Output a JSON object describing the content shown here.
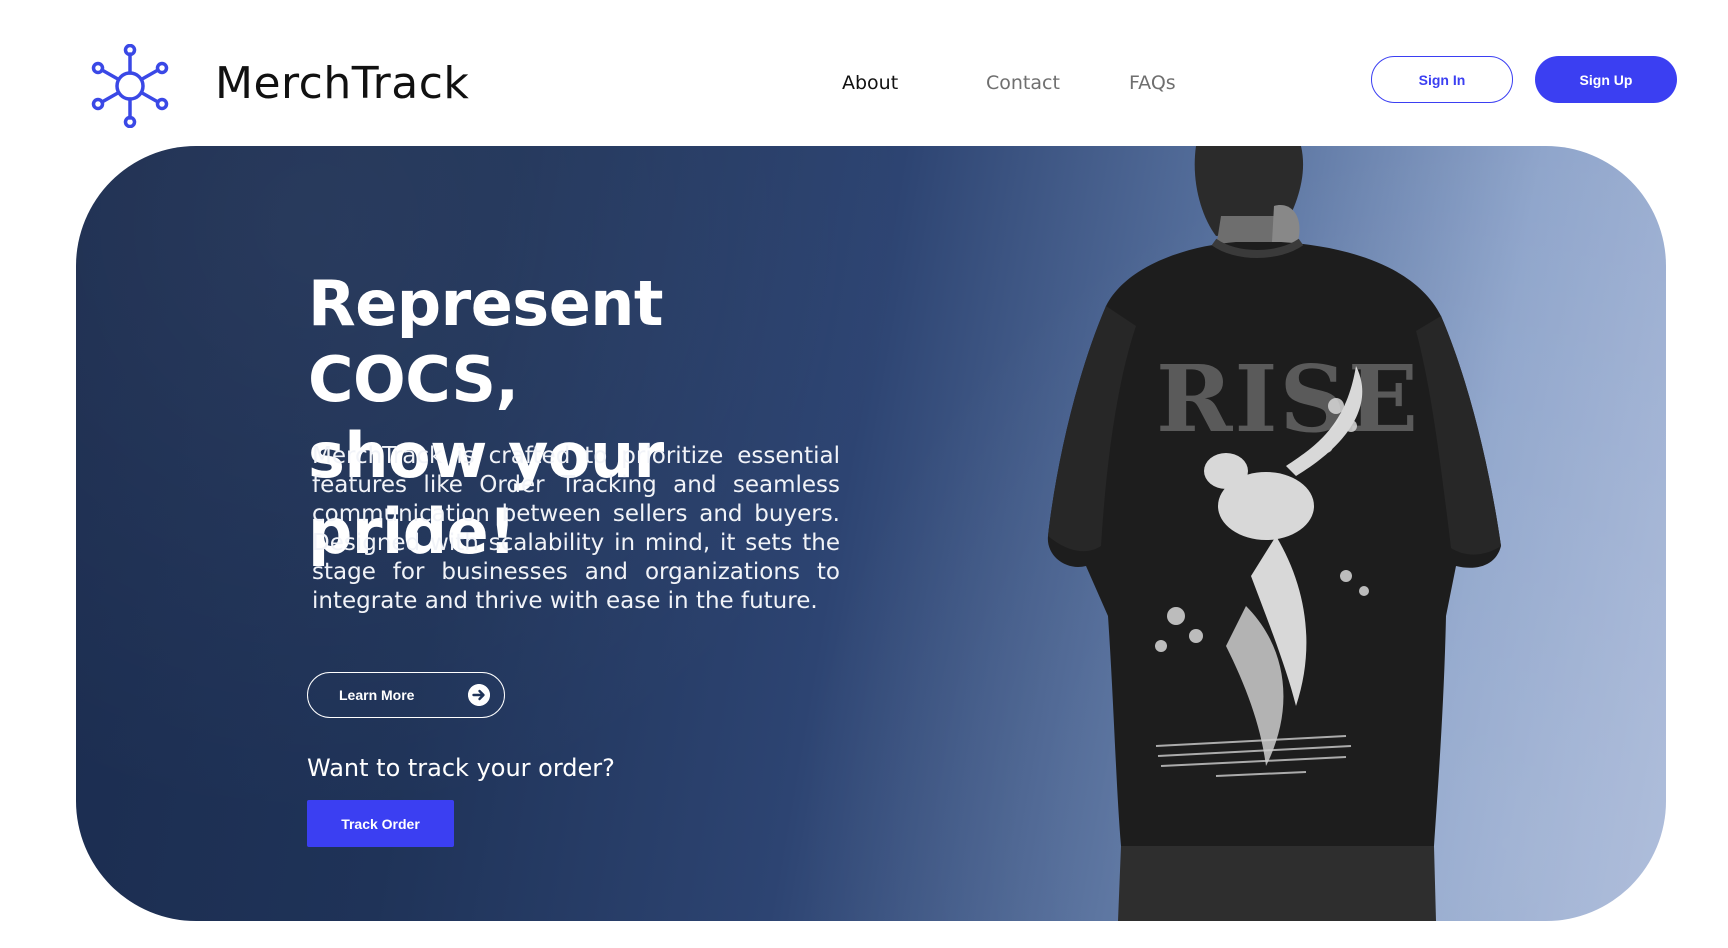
{
  "header": {
    "brand": "MerchTrack",
    "logo_icon": "network-hub-icon",
    "nav": {
      "about": "About",
      "contact": "Contact",
      "faqs": "FAQs"
    },
    "sign_in": "Sign In",
    "sign_up": "Sign Up"
  },
  "hero": {
    "title_line1": "Represent COCS,",
    "title_line2": "show your pride!",
    "description": "MerchTrack is crafted to prioritize essential features like Order Tracking and seamless communication between sellers and buyers. Designed with scalability in mind, it sets the stage for businesses and organizations to integrate and thrive with ease in the future.",
    "learn_more": "Learn More",
    "learn_more_icon": "arrow-right-circle-icon",
    "track_question": "Want to track your order?",
    "track_order": "Track Order",
    "shirt_print_text": "RISE"
  },
  "colors": {
    "accent": "#3b3ff2",
    "hero_dark": "#1b2c4f",
    "hero_light": "#a8b8d8"
  }
}
